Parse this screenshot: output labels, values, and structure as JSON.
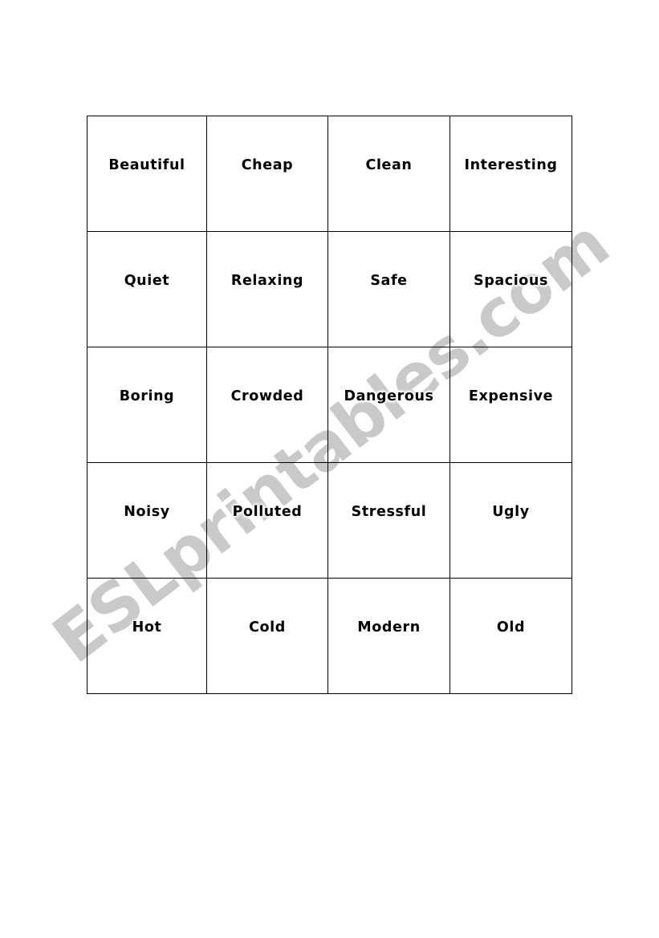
{
  "document": {
    "type": "word-card-worksheet",
    "page_background": "#ffffff"
  },
  "watermark": {
    "text": "ESLprintables.com",
    "color": "#c9c9c9",
    "rotation_degrees": -37.5
  },
  "table": {
    "columns": 4,
    "rows": 5,
    "border_color": "#000000",
    "text_color": "#000000",
    "cells": [
      [
        "Beautiful",
        "Cheap",
        "Clean",
        "Interesting"
      ],
      [
        "Quiet",
        "Relaxing",
        "Safe",
        "Spacious"
      ],
      [
        "Boring",
        "Crowded",
        "Dangerous",
        "Expensive"
      ],
      [
        "Noisy",
        "Polluted",
        "Stressful",
        "Ugly"
      ],
      [
        "Hot",
        "Cold",
        "Modern",
        "Old"
      ]
    ]
  }
}
